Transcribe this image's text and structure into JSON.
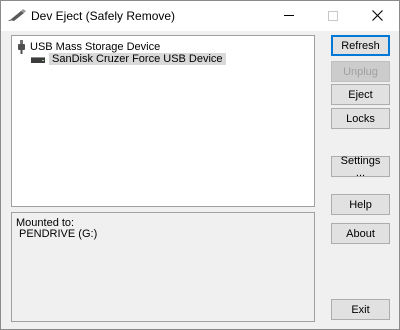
{
  "window": {
    "title": "Dev Eject (Safely Remove)",
    "icon": "eject-pen-icon"
  },
  "tree": {
    "root_label": "USB Mass Storage Device",
    "child_label": "SanDisk Cruzer Force USB Device",
    "selected": "SanDisk Cruzer Force USB Device"
  },
  "info": {
    "heading": "Mounted to:",
    "value": "PENDRIVE (G:)"
  },
  "buttons": {
    "refresh": "Refresh",
    "unplug": "Unplug",
    "eject": "Eject",
    "locks": "Locks",
    "settings": "Settings ...",
    "help": "Help",
    "about": "About",
    "exit": "Exit"
  },
  "colors": {
    "accent": "#0078d7",
    "selection": "#d9d9d9",
    "face": "#f0f0f0"
  }
}
